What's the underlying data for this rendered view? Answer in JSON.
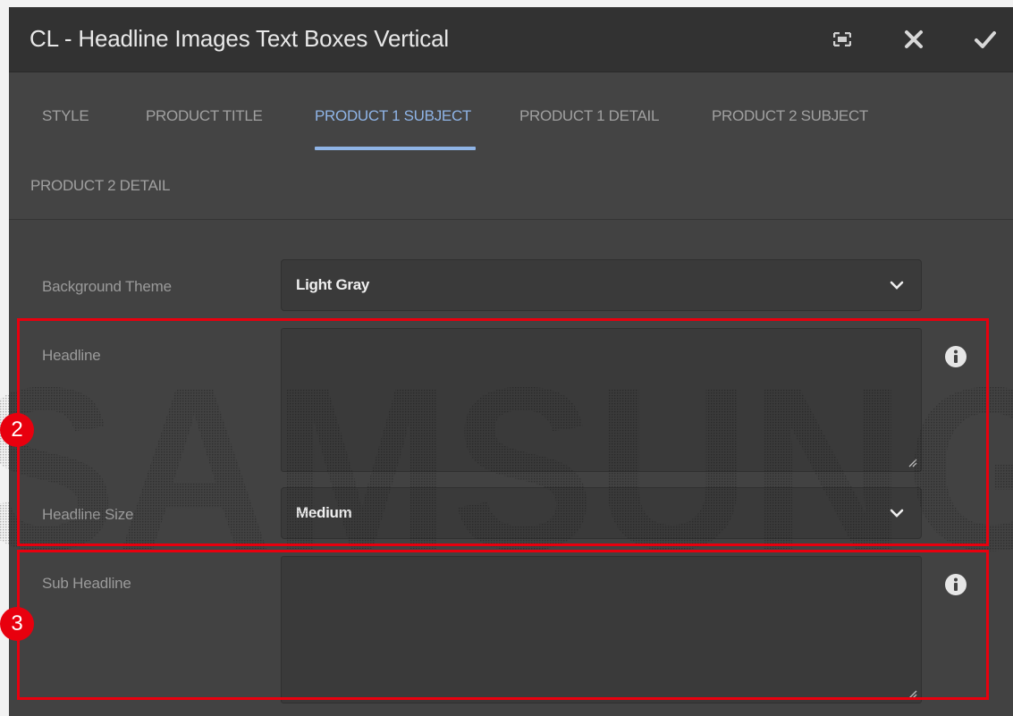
{
  "dialog": {
    "title": "CL - Headline Images Text Boxes Vertical",
    "actions": [
      "fullscreen-icon",
      "close-icon",
      "check-icon"
    ]
  },
  "tabs": [
    {
      "label": "STYLE",
      "active": false
    },
    {
      "label": "PRODUCT TITLE",
      "active": false
    },
    {
      "label": "PRODUCT 1 SUBJECT",
      "active": true
    },
    {
      "label": "PRODUCT 1 DETAIL",
      "active": false
    },
    {
      "label": "PRODUCT 2 SUBJECT",
      "active": false
    },
    {
      "label": "PRODUCT 2 DETAIL",
      "active": false
    }
  ],
  "form": {
    "background_theme": {
      "label": "Background Theme",
      "value": "Light Gray"
    },
    "headline": {
      "label": "Headline",
      "value": ""
    },
    "headline_size": {
      "label": "Headline Size",
      "value": "Medium"
    },
    "sub_headline": {
      "label": "Sub Headline",
      "value": ""
    }
  },
  "annotations": {
    "badge_2": "2",
    "badge_3": "3"
  },
  "watermark": {
    "text": "SAMSUNG"
  },
  "colors": {
    "accent": "#8fb4e6",
    "highlight": "#e8000e",
    "background": "#424242"
  }
}
